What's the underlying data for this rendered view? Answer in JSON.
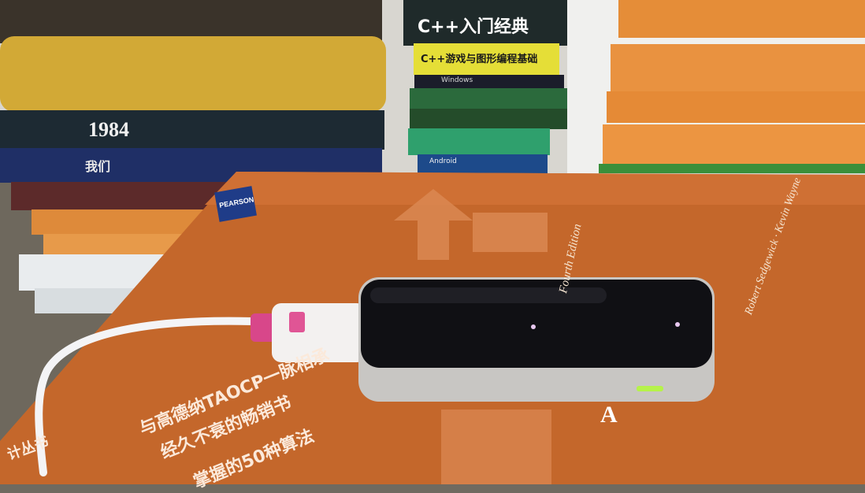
{
  "scene": {
    "left_stack_titles": [
      "1984",
      "我们"
    ],
    "middle_stack_titles": [
      "C++入门经典",
      "C++游戏与图形编程基础",
      "Windows",
      "Android"
    ],
    "front_book": {
      "publisher": "PEARSON",
      "edition": "Fourth Edition",
      "authors": "Robert Sedgewick · Kevin Wayne",
      "slogan_1": "与高德纳TAOCP一脉相承",
      "slogan_2": "经久不衰的畅销书",
      "slogan_3": "掌握的50种算法",
      "series": "计丛书",
      "letter": "A"
    },
    "device": {
      "name": "Leap Motion controller",
      "indicator_color": "#b6f24a"
    }
  },
  "colors": {
    "orange_book": "#c8692a",
    "orange_spine": "#e8923b",
    "device_body": "#c9c7c4",
    "device_top": "#131316"
  }
}
